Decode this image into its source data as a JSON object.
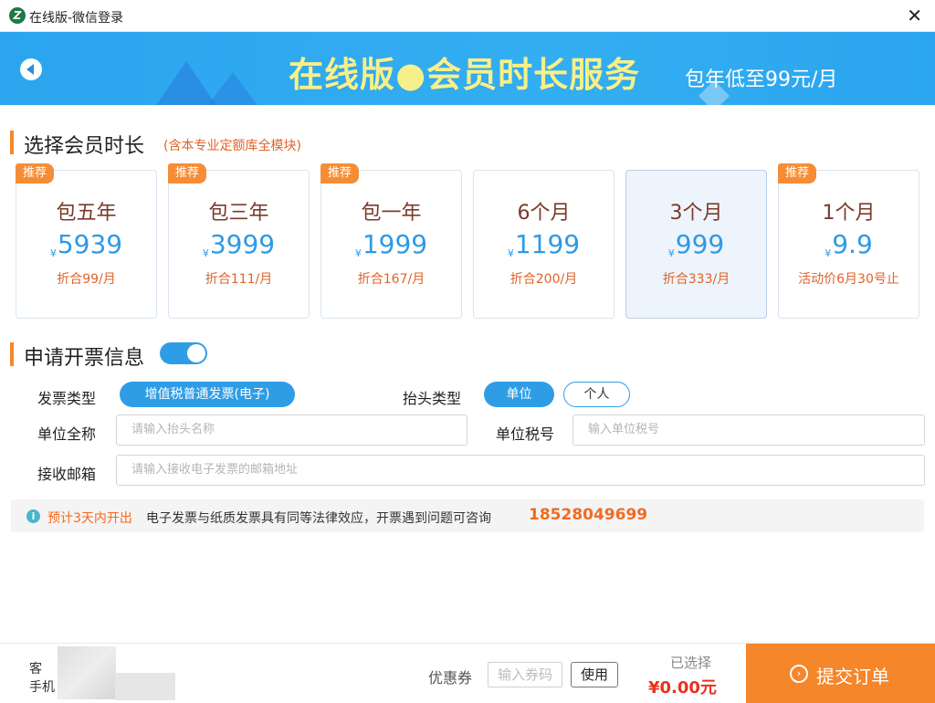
{
  "window": {
    "title": "在线版-微信登录",
    "app_icon": "app-logo-icon",
    "close_glyph": "✕"
  },
  "banner": {
    "title": "在线版●会员时长服务",
    "subtitle": "包年低至99元/月"
  },
  "membership": {
    "heading": "选择会员时长",
    "note": "(含本专业定额库全模块)",
    "plans": [
      {
        "name": "包五年",
        "currency": "¥",
        "price": "5939",
        "unit": "折合99/月",
        "tag": "推荐",
        "selected": false
      },
      {
        "name": "包三年",
        "currency": "¥",
        "price": "3999",
        "unit": "折合111/月",
        "tag": "推荐",
        "selected": false
      },
      {
        "name": "包一年",
        "currency": "¥",
        "price": "1999",
        "unit": "折合167/月",
        "tag": "推荐",
        "selected": false
      },
      {
        "name": "6个月",
        "currency": "¥",
        "price": "1199",
        "unit": "折合200/月",
        "tag": "",
        "selected": false
      },
      {
        "name": "3个月",
        "currency": "¥",
        "price": "999",
        "unit": "折合333/月",
        "tag": "",
        "selected": true
      },
      {
        "name": "1个月",
        "currency": "¥",
        "price": "9.9",
        "unit": "活动价6月30号止",
        "tag": "推荐",
        "selected": false
      }
    ]
  },
  "invoice": {
    "heading": "申请开票信息",
    "enabled": true,
    "type_label": "发票类型",
    "type_option": "增值税普通发票(电子)",
    "header_type_label": "抬头类型",
    "header_options": {
      "unit": "单位",
      "personal": "个人"
    },
    "company_label": "单位全称",
    "company_placeholder": "请输入抬头名称",
    "tax_label": "单位税号",
    "tax_placeholder": "输入单位税号",
    "email_label": "接收邮箱",
    "email_placeholder": "请输入接收电子发票的邮箱地址"
  },
  "notice": {
    "highlight": "预计3天内开出",
    "text": "电子发票与纸质发票具有同等法律效应，开票遇到问题可咨询",
    "phone": "18528049699"
  },
  "footer": {
    "account_label": "客",
    "phone_label": "手机",
    "coupon_label": "优惠券",
    "coupon_placeholder": "输入券码",
    "use_button": "使用",
    "selected_label": "已选择",
    "total": "¥0.00元",
    "submit": "提交订单"
  },
  "colors": {
    "accent": "#2f9de6",
    "orange": "#f5862a",
    "banner": "#2aa5ee",
    "price": "#2e9ae6"
  }
}
